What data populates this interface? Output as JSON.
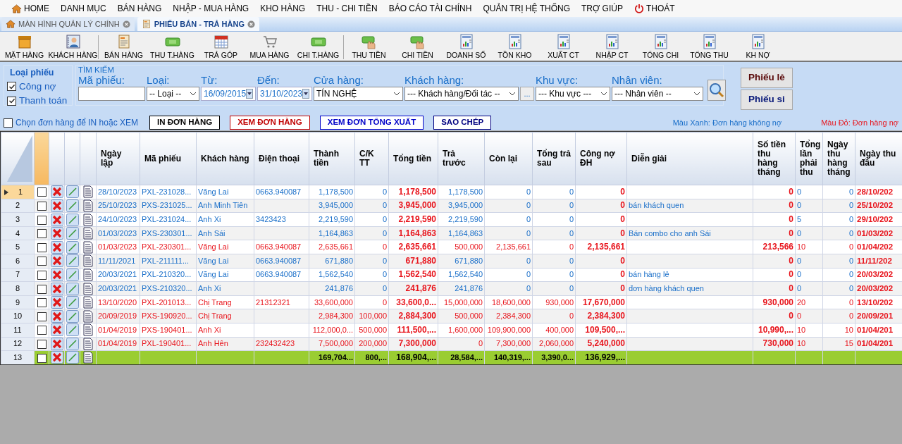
{
  "menu": [
    {
      "label": "HOME",
      "kind": "home"
    },
    {
      "label": "DANH MỤC"
    },
    {
      "label": "BÁN HÀNG"
    },
    {
      "label": "NHẬP - MUA HÀNG"
    },
    {
      "label": "KHO HÀNG"
    },
    {
      "label": "THU - CHI TIỀN"
    },
    {
      "label": "BÁO CÁO TÀI CHÍNH"
    },
    {
      "label": "QUẢN TRỊ HỆ THỐNG"
    },
    {
      "label": "TRỢ GIÚP"
    },
    {
      "label": "THOÁT",
      "kind": "power"
    }
  ],
  "tabs": [
    {
      "label": "MÀN HÌNH QUẢN LÝ CHÍNH",
      "kind": "home",
      "selected": false
    },
    {
      "label": "PHIẾU BÁN - TRẢ HÀNG",
      "kind": "invoice",
      "selected": true
    }
  ],
  "toolbar": [
    [
      {
        "label": "MẶT HÀNG",
        "kind": "box"
      },
      {
        "label": "KHÁCH HÀNG",
        "kind": "contact"
      }
    ],
    [
      {
        "label": "BÁN HÀNG",
        "kind": "invoice"
      },
      {
        "label": "THU T.HÀNG",
        "kind": "cash"
      },
      {
        "label": "TRẢ GÓP",
        "kind": "calendar"
      },
      {
        "label": "MUA HÀNG",
        "kind": "cart"
      },
      {
        "label": "CHI T.HÀNG",
        "kind": "cash"
      }
    ],
    [
      {
        "label": "THU TIỀN",
        "kind": "hand"
      },
      {
        "label": "CHI TIỀN",
        "kind": "hand"
      },
      {
        "label": "DOANH SỐ",
        "kind": "report"
      },
      {
        "label": "TỒN KHO",
        "kind": "report"
      },
      {
        "label": "XUẤT CT",
        "kind": "report"
      },
      {
        "label": "NHẬP CT",
        "kind": "report"
      },
      {
        "label": "TỔNG CHI",
        "kind": "report"
      },
      {
        "label": "TỔNG THU",
        "kind": "report"
      },
      {
        "label": "KH NỢ",
        "kind": "report"
      }
    ]
  ],
  "ticket_type": {
    "title": "Loại phiếu",
    "options": [
      {
        "label": "Công nợ",
        "checked": true
      },
      {
        "label": "Thanh toán",
        "checked": true
      }
    ]
  },
  "search": {
    "title": "TÌM KIẾM",
    "fields": [
      {
        "label": "Mã phiếu:",
        "kind": "text"
      },
      {
        "label": "Loại:",
        "kind": "select",
        "value": "-- Loại --"
      },
      {
        "label": "Từ:",
        "kind": "date",
        "value": "16/09/2015"
      },
      {
        "label": "Đến:",
        "kind": "date",
        "value": "31/10/2023"
      },
      {
        "label": "Cửa hàng:",
        "kind": "select",
        "value": "TÍN NGHỆ"
      },
      {
        "label": "Khách hàng:",
        "kind": "select",
        "value": "--- Khách hàng/Đối tác --",
        "more": "..."
      },
      {
        "label": "Khu vực:",
        "kind": "select",
        "value": "--- Khu vực ---"
      },
      {
        "label": "Nhân viên:",
        "kind": "select",
        "value": "--- Nhân viên --"
      }
    ]
  },
  "side_buttons": [
    "Phiếu lẻ",
    "Phiếu si"
  ],
  "select_option": {
    "label": "Chọn đơn hàng để IN hoặc XEM",
    "checked": false
  },
  "actions": [
    {
      "label": "IN ĐƠN HÀNG",
      "color": "#000000"
    },
    {
      "label": "XEM ĐƠN HÀNG",
      "color": "#c00000"
    },
    {
      "label": "XEM ĐƠN TỔNG XUẤT",
      "color": "#0000c8"
    },
    {
      "label": "SAO CHÉP",
      "color": "#000080"
    }
  ],
  "legend": [
    {
      "label": "Màu Xanh: Đơn hàng không nợ",
      "color": "#1a6fc9"
    },
    {
      "label": "Màu Đỏ: Đơn hàng nợ",
      "color": "#e8141c"
    }
  ],
  "table": {
    "columns": [
      {
        "label": "Ngày lập",
        "kind": "text"
      },
      {
        "label": "Mã phiếu",
        "kind": "text"
      },
      {
        "label": "Khách hàng",
        "kind": "text"
      },
      {
        "label": "Điện thoại",
        "kind": "text"
      },
      {
        "label": "Thành tiền",
        "kind": "number"
      },
      {
        "label": "C/K TT",
        "kind": "number"
      },
      {
        "label": "Tổng tiền",
        "kind": "key"
      },
      {
        "label": "Trả trước",
        "kind": "number"
      },
      {
        "label": "Còn lại",
        "kind": "number"
      },
      {
        "label": "Tổng trả sau",
        "kind": "number"
      },
      {
        "label": "Công nợ ĐH",
        "kind": "key"
      },
      {
        "label": "Diễn giải",
        "kind": "text"
      },
      {
        "label": "Số tiền thu hàng tháng",
        "kind": "key"
      },
      {
        "label": "Tổng lần phải thu",
        "kind": "count"
      },
      {
        "label": "Ngày thu hàng tháng",
        "kind": "number"
      },
      {
        "label": "Ngày thu đầu",
        "kind": "keytext"
      }
    ],
    "rows": [
      {
        "number": "1",
        "selected": true,
        "checked": false,
        "debt": false,
        "kind": "order",
        "cells": [
          "28/10/2023",
          "PXL-231028...",
          "Vãng Lai",
          "0663.940087",
          "1,178,500",
          "0",
          "1,178,500",
          "1,178,500",
          "0",
          "0",
          "0",
          null,
          "0",
          "0",
          "0",
          "28/10/202"
        ]
      },
      {
        "number": "2",
        "selected": false,
        "checked": false,
        "debt": false,
        "kind": "order",
        "cells": [
          "25/10/2023",
          "PXS-231025...",
          "Anh Minh Tiên",
          null,
          "3,945,000",
          "0",
          "3,945,000",
          "3,945,000",
          "0",
          "0",
          "0",
          "bán khách quen",
          "0",
          "0",
          "0",
          "25/10/202"
        ]
      },
      {
        "number": "3",
        "selected": false,
        "checked": false,
        "debt": false,
        "kind": "order",
        "cells": [
          "24/10/2023",
          "PXL-231024...",
          "Anh Xi",
          "3423423",
          "2,219,590",
          "0",
          "2,219,590",
          "2,219,590",
          "0",
          "0",
          "0",
          null,
          "0",
          "5",
          "0",
          "29/10/202"
        ]
      },
      {
        "number": "4",
        "selected": false,
        "checked": false,
        "debt": false,
        "kind": "order",
        "cells": [
          "01/03/2023",
          "PXS-230301...",
          "Anh Sái",
          null,
          "1,164,863",
          "0",
          "1,164,863",
          "1,164,863",
          "0",
          "0",
          "0",
          "Bán combo cho anh Sái",
          "0",
          "0",
          "0",
          "01/03/202"
        ]
      },
      {
        "number": "5",
        "selected": false,
        "checked": false,
        "debt": true,
        "kind": "order",
        "cells": [
          "01/03/2023",
          "PXL-230301...",
          "Vãng Lai",
          "0663.940087",
          "2,635,661",
          "0",
          "2,635,661",
          "500,000",
          "2,135,661",
          "0",
          "2,135,661",
          null,
          "213,566",
          "10",
          "0",
          "01/04/202"
        ]
      },
      {
        "number": "6",
        "selected": false,
        "checked": false,
        "debt": false,
        "kind": "order",
        "cells": [
          "11/11/2021",
          "PXL-211111...",
          "Vãng Lai",
          "0663.940087",
          "671,880",
          "0",
          "671,880",
          "671,880",
          "0",
          "0",
          "0",
          null,
          "0",
          "0",
          "0",
          "11/11/202"
        ]
      },
      {
        "number": "7",
        "selected": false,
        "checked": false,
        "debt": false,
        "kind": "order",
        "cells": [
          "20/03/2021",
          "PXL-210320...",
          "Vãng Lai",
          "0663.940087",
          "1,562,540",
          "0",
          "1,562,540",
          "1,562,540",
          "0",
          "0",
          "0",
          "bán hàng lẻ",
          "0",
          "0",
          "0",
          "20/03/202"
        ]
      },
      {
        "number": "8",
        "selected": false,
        "checked": false,
        "debt": false,
        "kind": "order",
        "cells": [
          "20/03/2021",
          "PXS-210320...",
          "Anh Xi",
          null,
          "241,876",
          "0",
          "241,876",
          "241,876",
          "0",
          "0",
          "0",
          "đơn hàng khách quen",
          "0",
          "0",
          "0",
          "20/03/202"
        ]
      },
      {
        "number": "9",
        "selected": false,
        "checked": false,
        "debt": true,
        "kind": "order",
        "cells": [
          "13/10/2020",
          "PXL-201013...",
          "Chị Trang",
          "21312321",
          "33,600,000",
          "0",
          "33,600,0...",
          "15,000,000",
          "18,600,000",
          "930,000",
          "17,670,000",
          null,
          "930,000",
          "20",
          "0",
          "13/10/202"
        ]
      },
      {
        "number": "10",
        "selected": false,
        "checked": false,
        "debt": true,
        "kind": "order",
        "cells": [
          "20/09/2019",
          "PXS-190920...",
          "Chị Trang",
          null,
          "2,984,300",
          "100,000",
          "2,884,300",
          "500,000",
          "2,384,300",
          "0",
          "2,384,300",
          null,
          "0",
          "0",
          "0",
          "20/09/201"
        ]
      },
      {
        "number": "11",
        "selected": false,
        "checked": false,
        "debt": true,
        "kind": "order",
        "cells": [
          "01/04/2019",
          "PXS-190401...",
          "Anh Xi",
          null,
          "112,000,0...",
          "500,000",
          "111,500,...",
          "1,600,000",
          "109,900,000",
          "400,000",
          "109,500,...",
          null,
          "10,990,...",
          "10",
          "10",
          "01/04/201"
        ]
      },
      {
        "number": "12",
        "selected": false,
        "checked": false,
        "debt": true,
        "kind": "order",
        "cells": [
          "01/04/2019",
          "PXL-190401...",
          "Anh Hên",
          "232432423",
          "7,500,000",
          "200,000",
          "7,300,000",
          "0",
          "7,300,000",
          "2,060,000",
          "5,240,000",
          null,
          "730,000",
          "10",
          "15",
          "01/04/201"
        ]
      },
      {
        "number": "13",
        "selected": false,
        "checked": false,
        "kind": "total",
        "cells": [
          null,
          null,
          null,
          null,
          "169,704...",
          "800,...",
          "168,904,...",
          "28,584,...",
          "140,319,...",
          "3,390,0...",
          "136,929,...",
          null,
          null,
          null,
          null,
          null
        ]
      }
    ]
  }
}
